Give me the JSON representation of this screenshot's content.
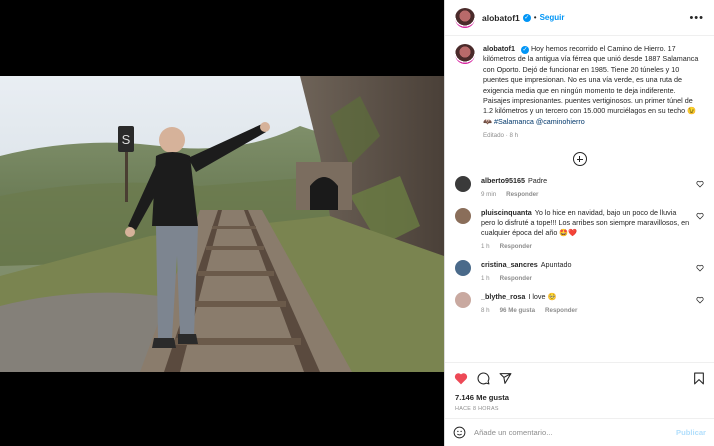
{
  "header": {
    "username": "alobatof1",
    "follow_label": "Seguir",
    "more_icon": "more-icon"
  },
  "caption": {
    "username": "alobatof1",
    "text": "Hoy hemos recorrido el Camino de Hierro. 17 kilómetros de la antigua vía férrea que unió desde 1887 Salamanca con Oporto. Dejó de funcionar en 1985. Tiene 20 túneles y 10 puentes que impresionan. No es una vía verde, es una ruta de exigencia media que en ningún momento te deja indiferente. Paisajes impresionantes. puentes vertiginosos. un primer túnel de 1.2 kilómetros y un tercero con 15.000 murciélagos en su techo 😉 🦇",
    "tags": "#Salamanca @caminohierro",
    "edited": "Editado · 8 h"
  },
  "comments": [
    {
      "user": "alberto95165",
      "text": "Padre",
      "time": "9 min",
      "likes": "",
      "reply": "Responder",
      "avatar_color": "#3a3a3a"
    },
    {
      "user": "pluiscinquanta",
      "text": "Yo lo hice en navidad, bajo un poco de lluvia pero lo disfruté a tope!!! Los arribes son siempre maravillosos, en cualquier época del año 🤩❤️",
      "time": "1 h",
      "likes": "",
      "reply": "Responder",
      "avatar_color": "#8a6e5a"
    },
    {
      "user": "cristina_sancres",
      "text": "Apuntado",
      "time": "1 h",
      "likes": "",
      "reply": "Responder",
      "avatar_color": "#4a6a8a"
    },
    {
      "user": "_blythe_rosa",
      "text": "I love 🥺",
      "time": "8 h",
      "likes": "96 Me gusta",
      "reply": "Responder",
      "avatar_color": "#c9a9a0"
    }
  ],
  "stats": {
    "likes": "7.146 Me gusta",
    "ago": "HACE 8 HORAS"
  },
  "add_comment": {
    "placeholder": "Añade un comentario...",
    "publish_label": "Publicar"
  },
  "colors": {
    "accent": "#0095f6",
    "like_red": "#ed4956",
    "muted": "#8e8e8e"
  }
}
